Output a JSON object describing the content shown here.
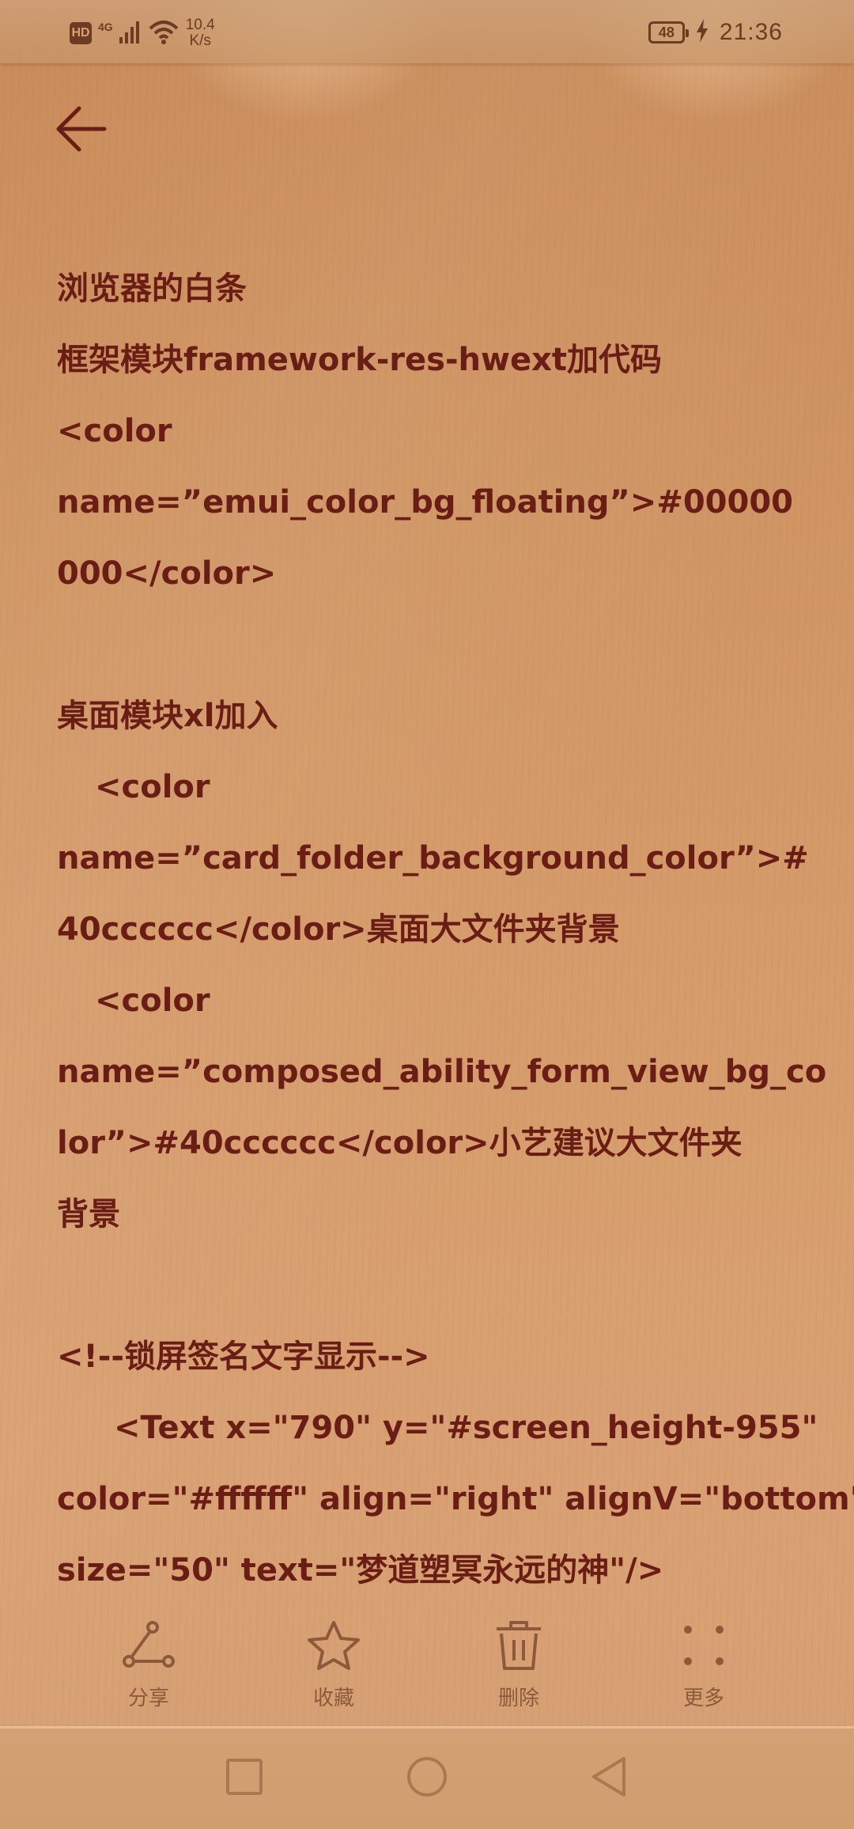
{
  "status_bar": {
    "hd": "HD",
    "network": "4G",
    "speed_value": "10.4",
    "speed_unit": "K/s",
    "battery": "48",
    "time": "21:36"
  },
  "header": {
    "back_icon": "arrow-left-icon"
  },
  "note": {
    "lines": [
      "浏览器的白条",
      "框架模块framework-res-hwext加代码",
      "<color",
      "name=”emui_color_bg_floating”>#00000",
      "000</color>",
      "",
      "桌面模块xl加入",
      "<color",
      "name=”card_folder_background_color”>#",
      "40cccccc</color>桌面大文件夹背景",
      "<color",
      "name=”composed_ability_form_view_bg_co",
      "lor”>#40cccccc</color>小艺建议大文件夹",
      "背景",
      "",
      "<!--锁屏签名文字显示-->",
      "<Text x=\"790\" y=\"#screen_height-955\"",
      "color=\"#ffffff\" align=\"right\" alignV=\"bottom\"",
      "size=\"50\" text=\"梦道塑冥永远的神\"/>"
    ]
  },
  "toolbar": {
    "share_label": "分享",
    "favorite_label": "收藏",
    "delete_label": "删除",
    "more_label": "更多"
  },
  "icons": {
    "share": "share-icon",
    "favorite": "star-icon",
    "delete": "trash-icon",
    "more": "more-dots-icon",
    "nav_recent": "square-icon",
    "nav_home": "circle-icon",
    "nav_back": "triangle-back-icon"
  },
  "colors": {
    "text": "#6a1d15",
    "toolbar_text": "#8a5a3a",
    "wood": "#d69c6b"
  }
}
